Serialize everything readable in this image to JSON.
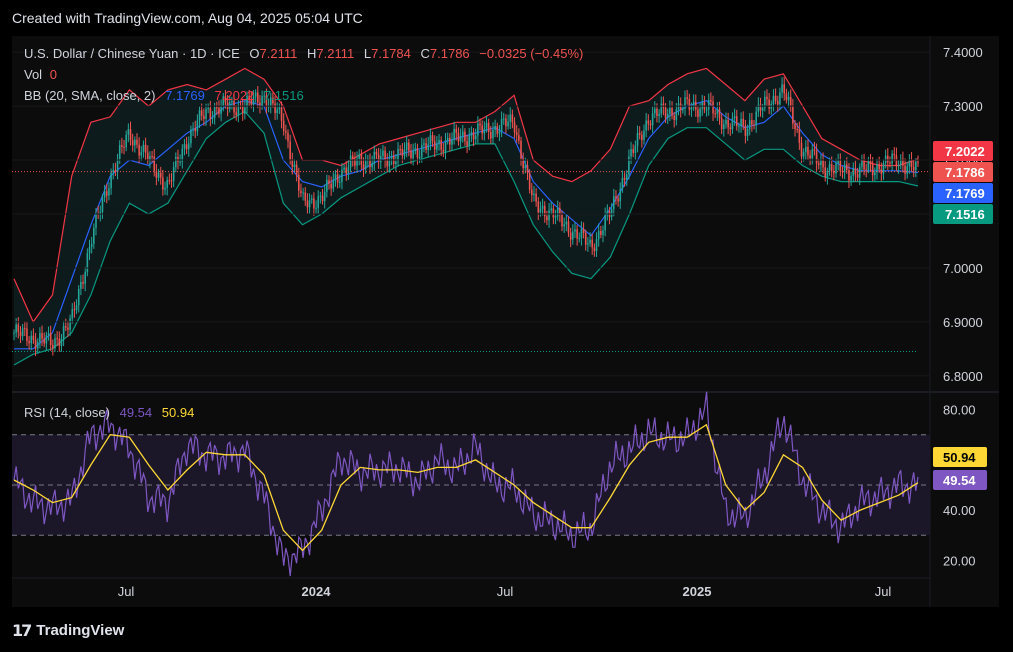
{
  "caption": "Created with TradingView.com, Aug 04, 2025 05:04 UTC",
  "header": {
    "symbol": "U.S. Dollar / Chinese Yuan · 1D · ICE",
    "o_label": "O",
    "o_value": "7.2111",
    "h_label": "H",
    "h_value": "7.2111",
    "l_label": "L",
    "l_value": "7.1784",
    "c_label": "C",
    "c_value": "7.1786",
    "change": "−0.0325 (−0.45%)",
    "vol_label": "Vol",
    "vol_value": "0",
    "bb_label": "BB (20, SMA, close, 2)",
    "bb_basis": "7.1769",
    "bb_upper": "7.2022",
    "bb_lower": "7.1516",
    "rsi_label": "RSI (14, close)",
    "rsi_value": "49.54",
    "rsi_ma": "50.94"
  },
  "brand": "TradingView",
  "colors": {
    "up": "#26a69a",
    "down": "#ef5350",
    "upper": "#f23645",
    "basis": "#2962ff",
    "lower": "#089981",
    "rsi": "#7e57c2",
    "rsi_ma": "#fdd835",
    "axis_text": "#d1d4dc"
  },
  "chart_data": [
    {
      "type": "candlestick",
      "title": "U.S. Dollar / Chinese Yuan · 1D · ICE",
      "ylim": [
        6.77,
        7.43
      ],
      "yticks": [
        "7.4000",
        "7.3000",
        "7.2000",
        "7.1000",
        "7.0000",
        "6.9000",
        "6.8000"
      ],
      "xticks": [
        "Jul",
        "2024",
        "Jul",
        "2025",
        "Jul"
      ],
      "price_labels": [
        "7.2022",
        "7.1786",
        "7.1769",
        "7.1516"
      ],
      "last_close": 7.1786,
      "reference_level": 6.845,
      "series": [
        {
          "name": "close",
          "values": [
            6.88,
            6.87,
            6.86,
            6.9,
            7.05,
            7.17,
            7.25,
            7.2,
            7.15,
            7.24,
            7.29,
            7.3,
            7.3,
            7.32,
            7.27,
            7.12,
            7.13,
            7.18,
            7.2,
            7.2,
            7.21,
            7.22,
            7.23,
            7.24,
            7.25,
            7.26,
            7.27,
            7.12,
            7.1,
            7.07,
            7.04,
            7.1,
            7.2,
            7.28,
            7.29,
            7.3,
            7.3,
            7.27,
            7.26,
            7.3,
            7.33,
            7.22,
            7.19,
            7.18,
            7.18,
            7.19,
            7.2,
            7.18
          ]
        },
        {
          "name": "BB (20, SMA, close, 2) basis",
          "values": [
            6.85,
            6.85,
            6.88,
            6.98,
            7.08,
            7.17,
            7.2,
            7.19,
            7.22,
            7.25,
            7.27,
            7.3,
            7.31,
            7.3,
            7.2,
            7.16,
            7.15,
            7.17,
            7.18,
            7.2,
            7.21,
            7.22,
            7.23,
            7.24,
            7.25,
            7.26,
            7.24,
            7.16,
            7.12,
            7.09,
            7.06,
            7.11,
            7.17,
            7.24,
            7.28,
            7.3,
            7.31,
            7.28,
            7.26,
            7.27,
            7.3,
            7.25,
            7.21,
            7.19,
            7.18,
            7.18,
            7.18,
            7.177
          ]
        },
        {
          "name": "BB (20, SMA, close, 2) upper",
          "values": [
            6.98,
            6.9,
            6.95,
            7.17,
            7.27,
            7.28,
            7.33,
            7.3,
            7.33,
            7.34,
            7.33,
            7.35,
            7.37,
            7.35,
            7.3,
            7.2,
            7.2,
            7.19,
            7.21,
            7.23,
            7.24,
            7.25,
            7.26,
            7.27,
            7.27,
            7.29,
            7.32,
            7.2,
            7.17,
            7.16,
            7.18,
            7.22,
            7.3,
            7.31,
            7.34,
            7.36,
            7.37,
            7.34,
            7.31,
            7.35,
            7.36,
            7.3,
            7.24,
            7.22,
            7.2,
            7.19,
            7.19,
            7.202
          ]
        },
        {
          "name": "BB (20, SMA, close, 2) lower",
          "values": [
            6.82,
            6.84,
            6.85,
            6.88,
            6.95,
            7.05,
            7.12,
            7.1,
            7.12,
            7.18,
            7.24,
            7.27,
            7.29,
            7.25,
            7.12,
            7.08,
            7.1,
            7.13,
            7.15,
            7.17,
            7.19,
            7.2,
            7.21,
            7.22,
            7.23,
            7.23,
            7.16,
            7.08,
            7.03,
            6.99,
            6.98,
            7.02,
            7.1,
            7.19,
            7.24,
            7.26,
            7.26,
            7.23,
            7.2,
            7.22,
            7.22,
            7.19,
            7.17,
            7.16,
            7.16,
            7.16,
            7.16,
            7.152
          ]
        }
      ]
    },
    {
      "type": "line",
      "title": "RSI (14, close)",
      "ylim": [
        13,
        87
      ],
      "yticks": [
        "80.00",
        "40.00",
        "20.00"
      ],
      "bands": [
        30,
        50,
        70
      ],
      "value_labels": [
        "50.94",
        "49.54"
      ],
      "series": [
        {
          "name": "RSI (14, close)",
          "values": [
            52,
            43,
            41,
            44,
            70,
            74,
            65,
            45,
            43,
            66,
            62,
            61,
            64,
            45,
            20,
            24,
            40,
            61,
            55,
            56,
            57,
            51,
            60,
            56,
            65,
            50,
            49,
            38,
            35,
            30,
            33,
            58,
            64,
            71,
            68,
            69,
            80,
            39,
            37,
            54,
            77,
            52,
            40,
            33,
            43,
            46,
            50,
            49.5
          ]
        },
        {
          "name": "RSI MA",
          "values": [
            52,
            48,
            43,
            45,
            58,
            70,
            69,
            58,
            48,
            56,
            63,
            62,
            62,
            54,
            32,
            24,
            32,
            50,
            57,
            56,
            56,
            55,
            57,
            57,
            60,
            55,
            50,
            43,
            38,
            33,
            33,
            45,
            58,
            67,
            69,
            69,
            74,
            50,
            40,
            47,
            62,
            57,
            44,
            36,
            40,
            43,
            46,
            50.9
          ]
        }
      ]
    }
  ]
}
